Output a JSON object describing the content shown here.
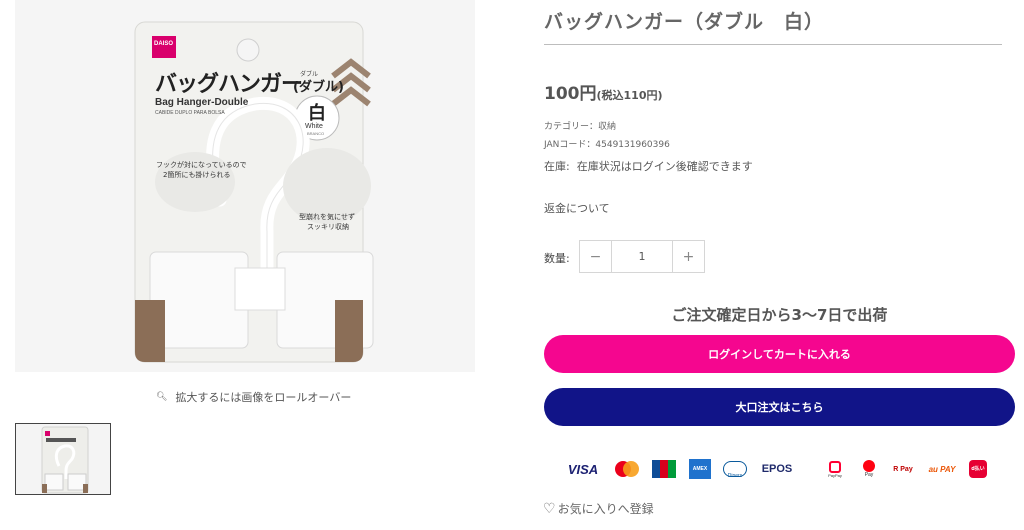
{
  "product": {
    "title": "バッグハンガー（ダブル　白）",
    "price": "100円",
    "price_tax": "(税込110円)",
    "category": "カテゴリー：収納",
    "jan": "JANコード：4549131960396",
    "stock_label": "在庫:",
    "stock_text": "在庫状況はログイン後確認できます",
    "refund_link": "返金について",
    "quantity_label": "数量:",
    "quantity_value": "1",
    "minus_symbol": "−",
    "plus_symbol": "+",
    "shipping_note": "ご注文確定日から3〜7日で出荷",
    "login_cart_button": "ログインしてカートに入れる",
    "bulk_order_button": "大口注文はこちら",
    "favorite_link": "お気に入りへ登録",
    "zoom_hint": "拡大するには画像をロールオーバー"
  },
  "package": {
    "brand": "DAISO",
    "name_jp": "バッグハンガー",
    "name_suffix": "(ダブル)",
    "name_en": "Bag Hanger-Double",
    "name_pt": "CABIDE DUPLO PARA BOLSA",
    "color_jp": "白",
    "color_en": "White",
    "color_pt": "BRANCO",
    "ruby": "ダブル",
    "feature_1_line1": "フックが対になっているので",
    "feature_1_line2": "2箇所にも掛けられる",
    "feature_2_line1": "型崩れを気にせず",
    "feature_2_line2": "スッキリ収納"
  },
  "payment_methods": [
    {
      "name": "VISA",
      "label": "VISA"
    },
    {
      "name": "mastercard",
      "label": ""
    },
    {
      "name": "JCB",
      "label": "JCB"
    },
    {
      "name": "AMERICAN EXPRESS",
      "label": "AMEX"
    },
    {
      "name": "Diners Club",
      "label": "Diners"
    },
    {
      "name": "EPOS",
      "label": "EPOS"
    },
    {
      "name": "PayPay",
      "label": "PayPay"
    },
    {
      "name": "merpay",
      "label": "Pay"
    },
    {
      "name": "楽天ペイ",
      "label": "R Pay"
    },
    {
      "name": "au PAY",
      "label": "au PAY"
    },
    {
      "name": "d払い",
      "label": "d払い"
    }
  ],
  "colors": {
    "login_button": "#f5068f",
    "bulk_button": "#111488",
    "package_brown": "#8b6e57",
    "daiso_pink": "#d9006c"
  }
}
